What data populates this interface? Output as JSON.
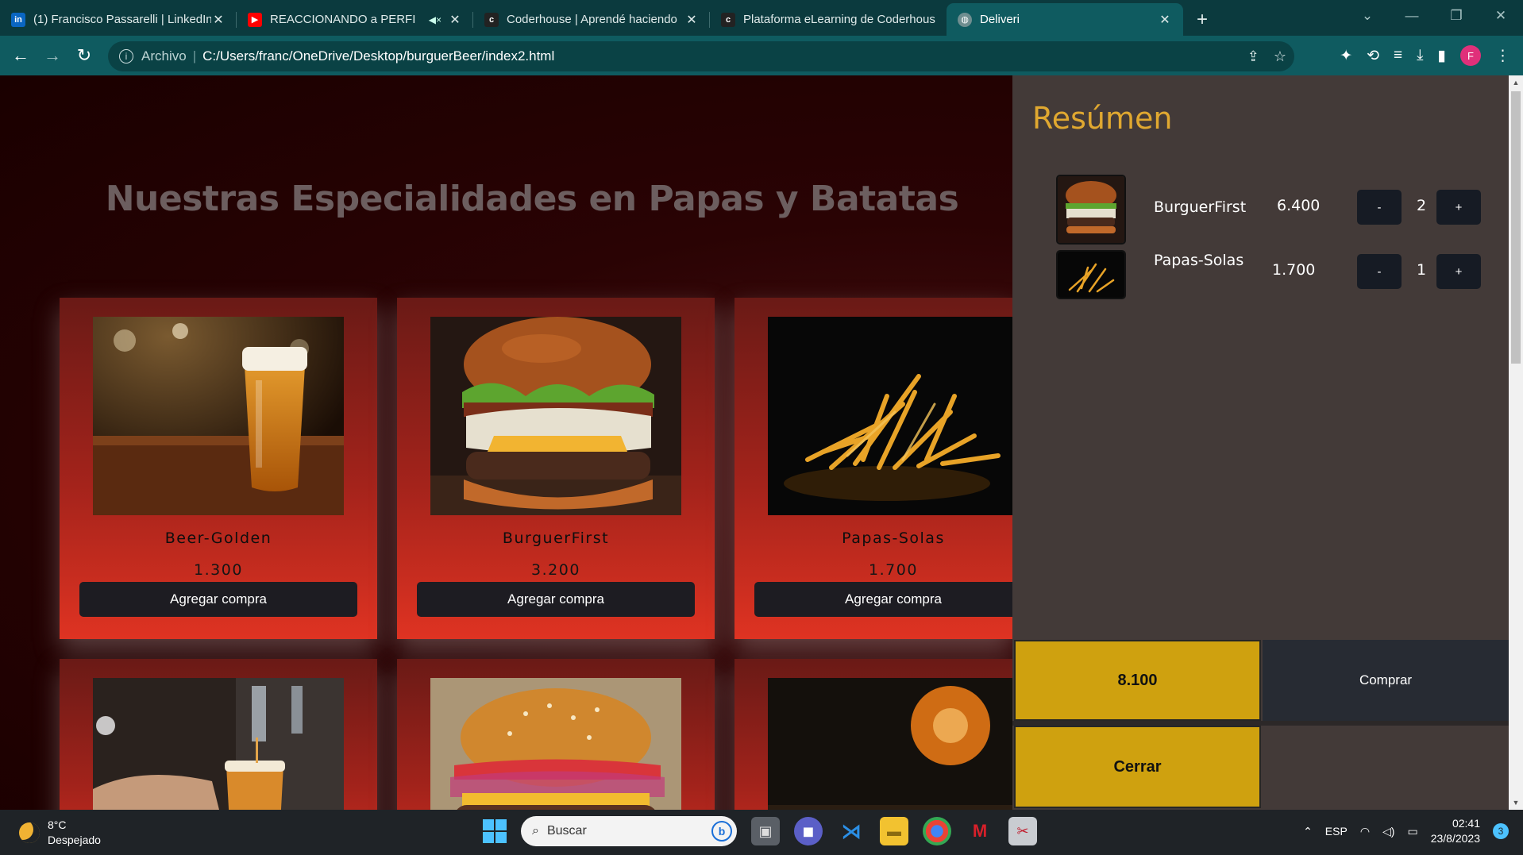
{
  "browser": {
    "tabs": [
      {
        "title": "(1) Francisco Passarelli | LinkedIn",
        "favicon": "linkedin-icon",
        "color": "#0a66c2",
        "active": false
      },
      {
        "title": "REACCIONANDO a PERFI",
        "favicon": "youtube-icon",
        "color": "#ff0000",
        "active": false,
        "muted": true
      },
      {
        "title": "Coderhouse | Aprendé haciendo",
        "favicon": "coderhouse-icon",
        "color": "#222222",
        "active": false
      },
      {
        "title": "Plataforma eLearning de Coderhouse",
        "favicon": "coderhouse-icon",
        "color": "#222222",
        "active": false
      },
      {
        "title": "Deliveri",
        "favicon": "globe-icon",
        "color": "#8aa",
        "active": true
      }
    ],
    "address": {
      "scheme": "Archivo",
      "url": "C:/Users/franc/OneDrive/Desktop/burguerBeer/index2.html"
    },
    "profile_initial": "F"
  },
  "page": {
    "heading": "Nuestras Especialidades en Papas y Batatas",
    "add_label": "Agregar compra",
    "products": [
      {
        "name": "Beer-Golden",
        "price": "1.300",
        "image": "beer"
      },
      {
        "name": "BurguerFirst",
        "price": "3.200",
        "image": "burger"
      },
      {
        "name": "Papas-Solas",
        "price": "1.700",
        "image": "fries"
      }
    ],
    "products_row2_images": [
      "beer-tap",
      "burger-2",
      "fries-night"
    ]
  },
  "cart": {
    "title": "Resúmen",
    "items": [
      {
        "name": "BurguerFirst",
        "price": "6.400",
        "qty": "2",
        "image": "burger"
      },
      {
        "name": "Papas-Solas",
        "price": "1.700",
        "qty": "1",
        "image": "fries"
      }
    ],
    "minus_label": "-",
    "plus_label": "+",
    "total": "8.100",
    "buy_label": "Comprar",
    "close_label": "Cerrar"
  },
  "taskbar": {
    "temperature": "8°C",
    "weather": "Despejado",
    "search_placeholder": "Buscar",
    "language": "ESP",
    "time": "02:41",
    "date": "23/8/2023",
    "notifications": "3"
  },
  "colors": {
    "accent": "#e0a830",
    "button": "#cfa10f",
    "card_bottom": "#df3322"
  }
}
